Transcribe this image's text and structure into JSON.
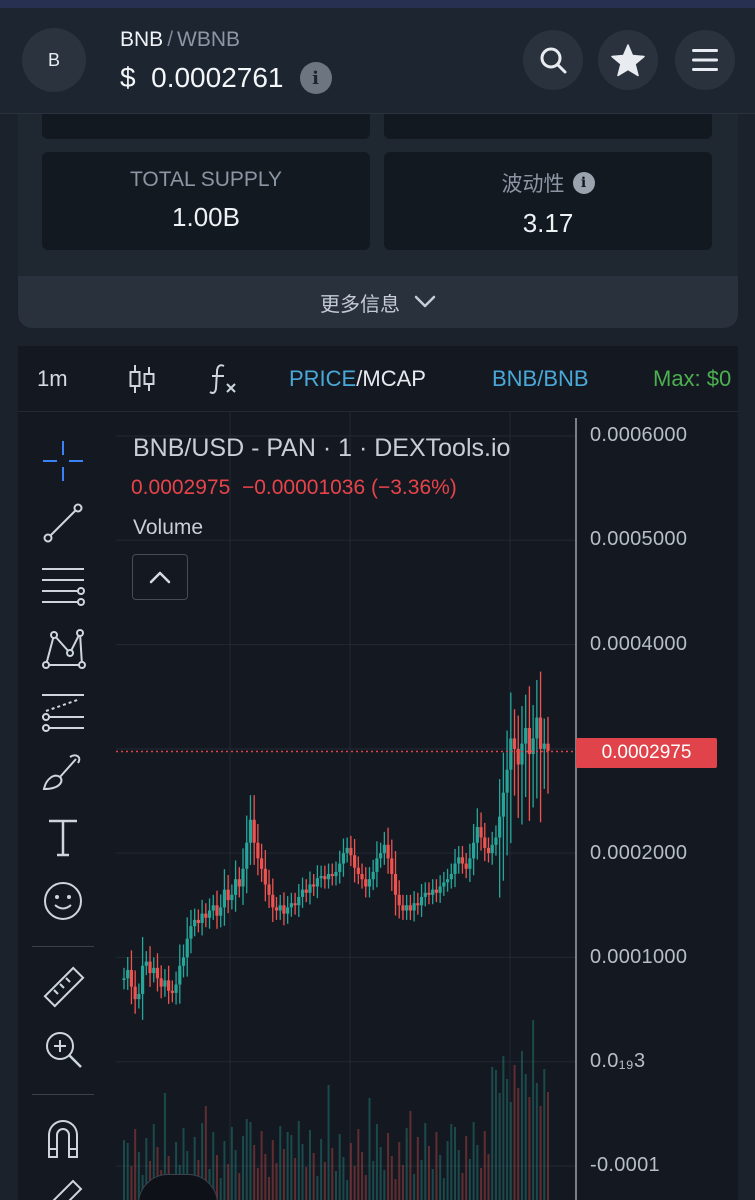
{
  "header": {
    "avatar_letter": "B",
    "base_symbol": "BNB",
    "separator": "/",
    "quote_symbol": "WBNB",
    "price": "$  0.0002761",
    "info_glyph": "i",
    "buttons": [
      "search-icon",
      "star-icon",
      "menu-icon"
    ]
  },
  "stats": {
    "total_supply_label": "TOTAL SUPPLY",
    "total_supply_value": "1.00B",
    "volatility_label": "波动性",
    "volatility_value": "3.17",
    "more_label": "更多信息"
  },
  "chart_toolbar": {
    "interval": "1m",
    "price_label": "PRICE",
    "slash": "/",
    "mcap_label": "MCAP",
    "pair_label": "BNB/BNB",
    "max_label": "Max: $0"
  },
  "chart_legend": {
    "title": "BNB/USD - PAN · 1 · DEXTools.io",
    "last_value": "0.0002975",
    "change": "−0.00001036 (−3.36%)",
    "volume_label": "Volume"
  },
  "y_axis": {
    "labels": [
      "0.0006000",
      "0.0005000",
      "0.0004000",
      "0.0002000",
      "0.0001000",
      "0.0₁₉3",
      "-0.0001"
    ],
    "current_price_tag": "0.0002975"
  },
  "colors": {
    "up": "#26a69a",
    "down": "#ef5350",
    "accent_blue": "#4aa8d8",
    "accent_green": "#4caf50",
    "price_tag": "#e0434a"
  },
  "chart_data": {
    "type": "candlestick",
    "series_name": "",
    "ylim": [
      -0.0001,
      0.0006
    ],
    "current_price": 0.0002975,
    "closes": [
      8e-05,
      8.8e-05,
      7.2e-05,
      6e-05,
      6.5e-05,
      9.2e-05,
      9.6e-05,
      8.5e-05,
      9e-05,
      8e-05,
      7.2e-05,
      7.8e-05,
      6.8e-05,
      6.6e-05,
      7.4e-05,
      9.2e-05,
      0.0001,
      0.000118,
      0.00013,
      0.000136,
      0.000133,
      0.000142,
      0.000138,
      0.000145,
      0.00015,
      0.00014,
      0.000148,
      0.000165,
      0.000155,
      0.00016,
      0.000175,
      0.000168,
      0.000185,
      0.00021,
      0.000232,
      0.00021,
      0.000195,
      0.000185,
      0.00017,
      0.00016,
      0.000148,
      0.000145,
      0.00015,
      0.000142,
      0.000148,
      0.000152,
      0.00015,
      0.000158,
      0.000165,
      0.000162,
      0.00017,
      0.000168,
      0.000176,
      0.000178,
      0.000175,
      0.00018,
      0.000178,
      0.000182,
      0.00019,
      0.0002,
      0.000205,
      0.000198,
      0.000186,
      0.00018,
      0.000175,
      0.000168,
      0.000175,
      0.000182,
      0.000195,
      0.0002,
      0.000208,
      0.000195,
      0.00018,
      0.00016,
      0.00015,
      0.000145,
      0.00015,
      0.000145,
      0.000152,
      0.00015,
      0.000158,
      0.000162,
      0.00016,
      0.000165,
      0.000162,
      0.000168,
      0.000172,
      0.000175,
      0.00018,
      0.00019,
      0.000196,
      0.00019,
      0.000185,
      0.000195,
      0.00021,
      0.000225,
      0.000215,
      0.000205,
      0.0002,
      0.000208,
      0.000215,
      0.000235,
      0.000258,
      0.00028,
      0.00031,
      0.0003,
      0.000285,
      0.000305,
      0.00032,
      0.000295,
      0.00031,
      0.00033,
      0.0003,
      0.000305,
      0.000298
    ]
  }
}
